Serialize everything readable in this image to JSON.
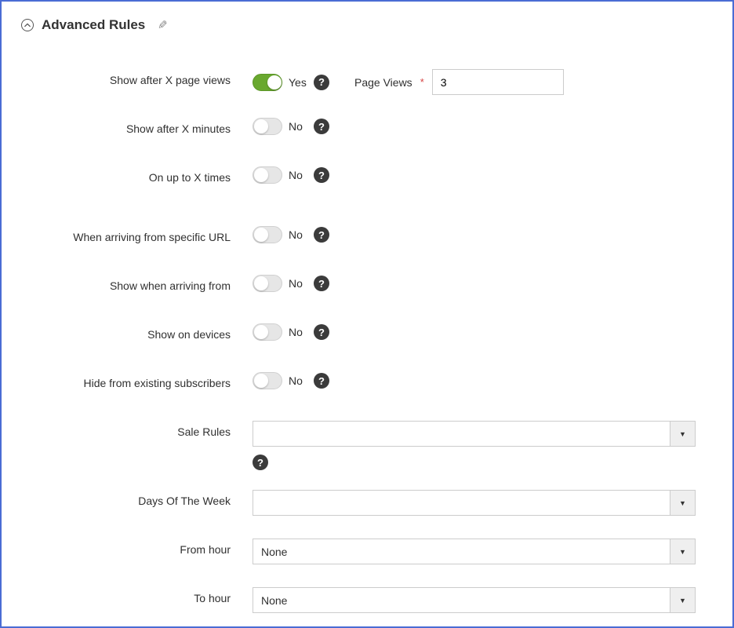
{
  "section": {
    "title": "Advanced Rules"
  },
  "rows": {
    "pageviews": {
      "label": "Show after X page views",
      "toggle_state": "Yes",
      "field_label": "Page Views",
      "field_value": "3"
    },
    "minutes": {
      "label": "Show after X minutes",
      "toggle_state": "No"
    },
    "times": {
      "label": "On up to X times",
      "toggle_state": "No"
    },
    "fromurl": {
      "label": "When arriving from specific URL",
      "toggle_state": "No"
    },
    "arriving": {
      "label": "Show when arriving from",
      "toggle_state": "No"
    },
    "devices": {
      "label": "Show on devices",
      "toggle_state": "No"
    },
    "hide_subs": {
      "label": "Hide from existing subscribers",
      "toggle_state": "No"
    },
    "sale_rules": {
      "label": "Sale Rules",
      "value": ""
    },
    "days": {
      "label": "Days Of The Week",
      "value": ""
    },
    "from_hour": {
      "label": "From hour",
      "value": "None"
    },
    "to_hour": {
      "label": "To hour",
      "value": "None"
    }
  }
}
